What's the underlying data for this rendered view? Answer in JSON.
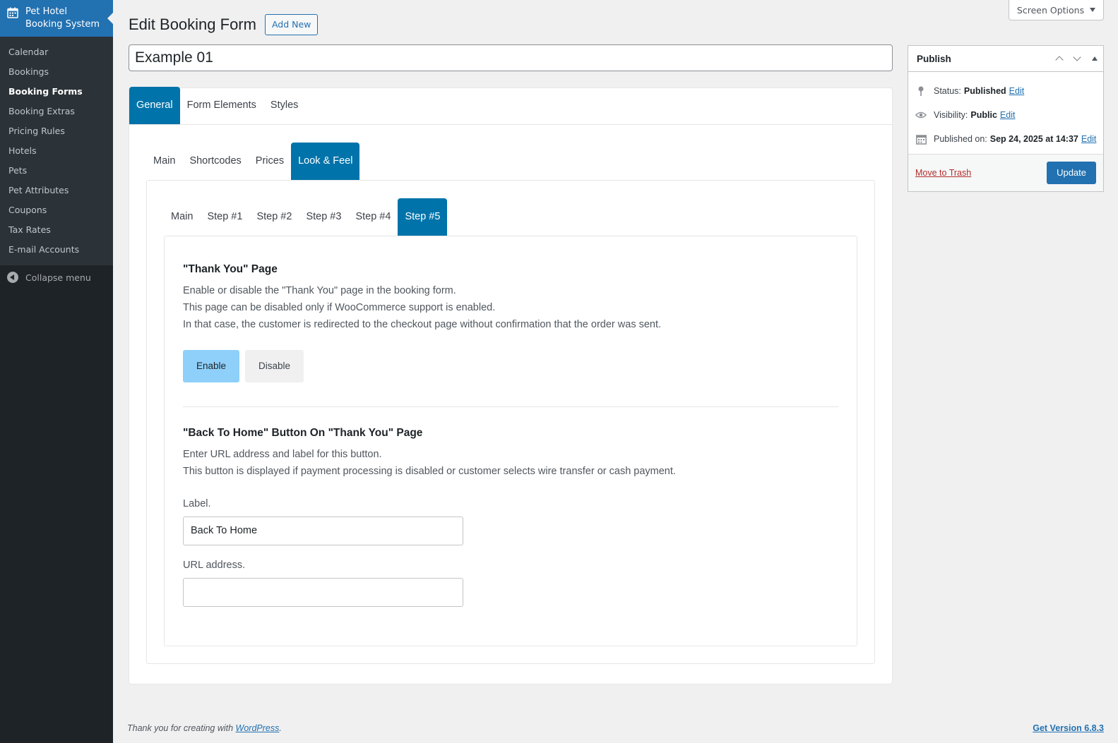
{
  "sidebar": {
    "plugin_title_line1": "Pet Hotel",
    "plugin_title_line2": "Booking System",
    "items": [
      {
        "label": "Calendar"
      },
      {
        "label": "Bookings"
      },
      {
        "label": "Booking Forms",
        "current": true
      },
      {
        "label": "Booking Extras"
      },
      {
        "label": "Pricing Rules"
      },
      {
        "label": "Hotels"
      },
      {
        "label": "Pets"
      },
      {
        "label": "Pet Attributes"
      },
      {
        "label": "Coupons"
      },
      {
        "label": "Tax Rates"
      },
      {
        "label": "E-mail Accounts"
      }
    ],
    "collapse_label": "Collapse menu"
  },
  "screen_options": "Screen Options",
  "page": {
    "title": "Edit Booking Form",
    "add_new": "Add New",
    "form_title_value": "Example 01"
  },
  "tabs_level1": [
    {
      "label": "General",
      "active": true
    },
    {
      "label": "Form Elements"
    },
    {
      "label": "Styles"
    }
  ],
  "tabs_level2": [
    {
      "label": "Main"
    },
    {
      "label": "Shortcodes"
    },
    {
      "label": "Prices"
    },
    {
      "label": "Look & Feel",
      "active": true
    }
  ],
  "tabs_level3": [
    {
      "label": "Main"
    },
    {
      "label": "Step #1"
    },
    {
      "label": "Step #2"
    },
    {
      "label": "Step #3"
    },
    {
      "label": "Step #4"
    },
    {
      "label": "Step #5",
      "active": true
    }
  ],
  "thank_you": {
    "title": "\"Thank You\" Page",
    "desc1": "Enable or disable the \"Thank You\" page in the booking form.",
    "desc2": "This page can be disabled only if WooCommerce support is enabled.",
    "desc3": "In that case, the customer is redirected to the checkout page without confirmation that the order was sent.",
    "enable": "Enable",
    "disable": "Disable",
    "selected": "Enable"
  },
  "back_home": {
    "title": "\"Back To Home\" Button On \"Thank You\" Page",
    "desc1": "Enter URL address and label for this button.",
    "desc2": "This button is displayed if payment processing is disabled or customer selects wire transfer or cash payment.",
    "label_field": "Label.",
    "label_value": "Back To Home",
    "url_field": "URL address.",
    "url_value": ""
  },
  "publish": {
    "title": "Publish",
    "status_label": "Status:",
    "status_value": "Published",
    "visibility_label": "Visibility:",
    "visibility_value": "Public",
    "published_label": "Published on:",
    "published_value": "Sep 24, 2025 at 14:37",
    "edit": "Edit",
    "trash": "Move to Trash",
    "update": "Update"
  },
  "footer": {
    "thanks_prefix": "Thank you for creating with ",
    "thanks_link": "WordPress",
    "thanks_suffix": ".",
    "version": "Get Version 6.8.3"
  },
  "colors": {
    "admin_dark": "#1d2327",
    "admin_blue": "#2271b1",
    "tab_active": "#0073aa",
    "enable_on": "#8fd0fb"
  }
}
